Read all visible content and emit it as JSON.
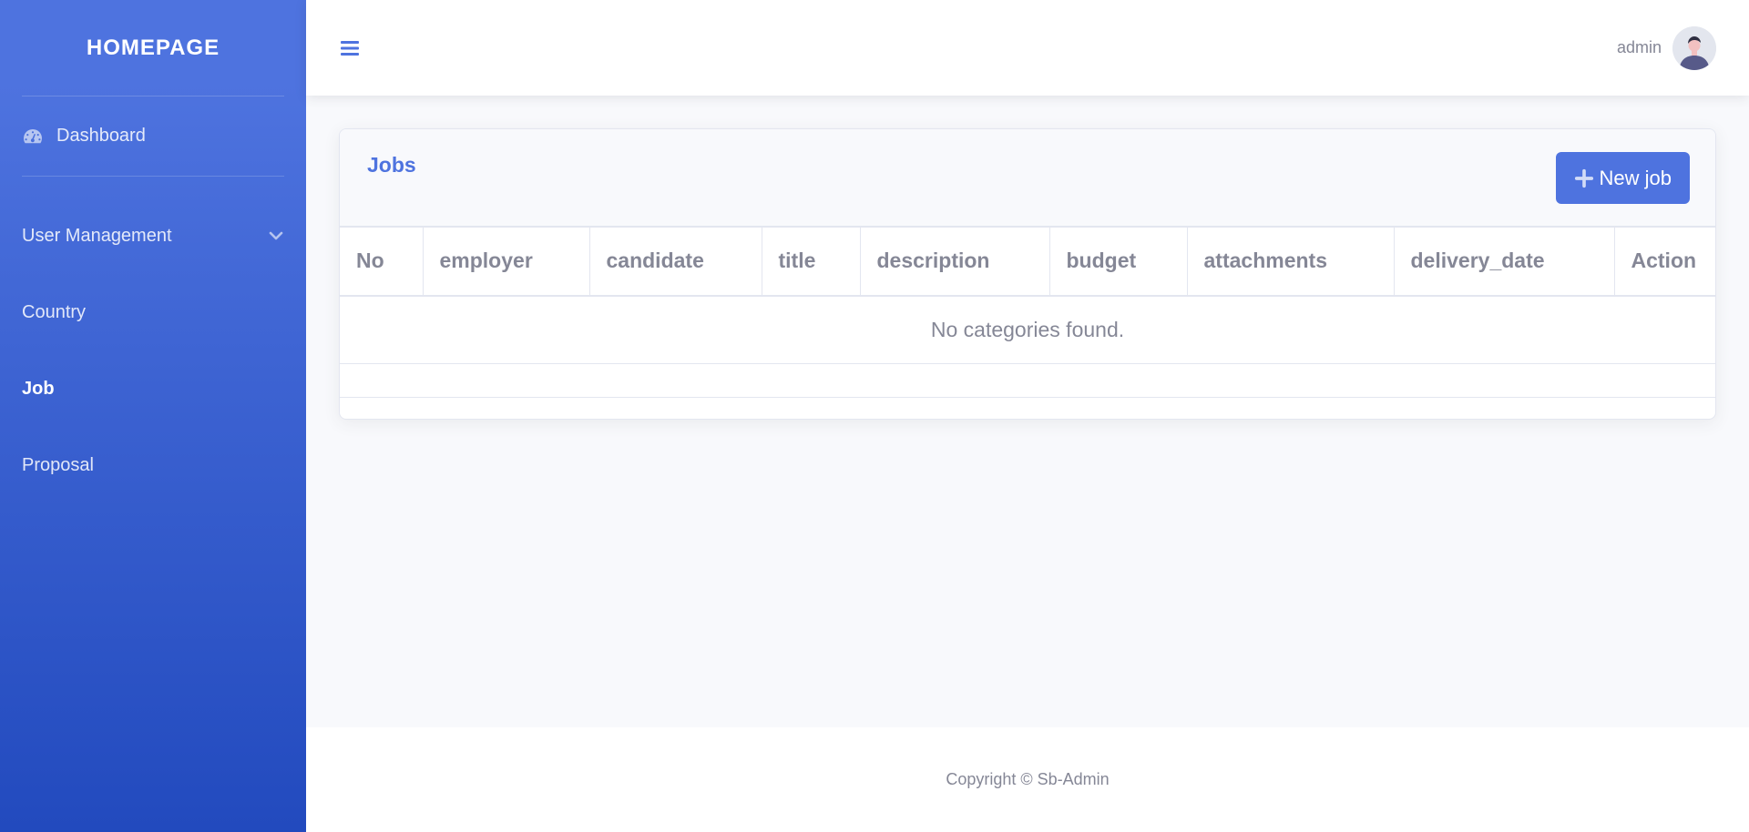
{
  "sidebar": {
    "brand": "HOMEPAGE",
    "dashboard": {
      "label": "Dashboard",
      "icon": "tachometer-icon"
    },
    "items": [
      {
        "label": "User Management",
        "icon": "chevron-down-icon"
      },
      {
        "label": "Country"
      },
      {
        "label": "Job",
        "active": true
      },
      {
        "label": "Proposal"
      }
    ]
  },
  "topbar": {
    "menu_icon": "hamburger-icon",
    "username": "admin",
    "avatar_icon": "avatar-icon"
  },
  "card": {
    "title": "Jobs",
    "new_button": {
      "label": "New job",
      "icon": "plus-icon"
    },
    "columns": [
      "No",
      "employer",
      "candidate",
      "title",
      "description",
      "budget",
      "attachments",
      "delivery_date",
      "Action"
    ],
    "empty_message": "No categories found."
  },
  "footer": {
    "text": "Copyright © Sb-Admin"
  },
  "colors": {
    "primary": "#4e73df",
    "primary_dark": "#224abe",
    "muted": "#858796"
  }
}
